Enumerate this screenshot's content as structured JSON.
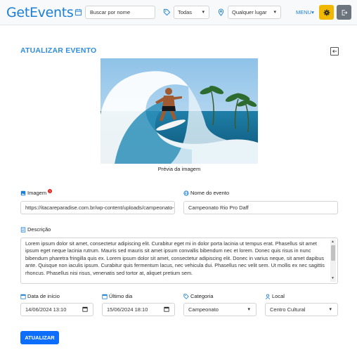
{
  "navbar": {
    "brand": "GetEvents",
    "search_placeholder": "Buscar por nome",
    "category_value": "Todas",
    "location_value": "Qualquer lugar",
    "menu_label": "MENU",
    "chevron": "▾"
  },
  "page": {
    "title": "ATUALIZAR EVENTO",
    "preview_caption": "Prévia da imagem"
  },
  "form": {
    "image_label": "Imagem",
    "image_value": "https://itacareparadise.com.br/wp-content/uploads/campeonato-surf.jpg",
    "name_label": "Nome do evento",
    "name_value": "Campeonato Rio Pro Daff",
    "description_label": "Descrição",
    "description_value": "Lorem ipsum dolor sit amet, consectetur adipiscing elit. Curabitur eget mi in dolor porta lacinia ut tempus erat. Phasellus sit amet ipsum eget neque lacinia rutrum. Mauris sed mauris sit amet ipsum convallis bibendum nec et lorem. Donec quis risus in nunc bibendum pharetra fringilla quis ex. Lorem ipsum dolor sit amet, consectetur adipiscing elit. Donec in varius neque, sit amet dapibus ante. Quisque non iaculis ipsum. Curabitur quis fermentum lacus, nec vehicula dui. Phasellus nec velit sem. Ut mollis ex nec sagittis rhoncus. Phasellus nisi risus, venenatis sed tortor at, aliquet pretium sem.",
    "start_label": "Data de início",
    "start_value": "14/06/2024 13:10",
    "end_label": "Último dia",
    "end_value": "15/06/2024 18:10",
    "category_label": "Categoria",
    "category_value": "Campeonato",
    "location_label": "Local",
    "location_value": "Centro Cultural",
    "submit_label": "ATUALIZAR"
  },
  "colors": {
    "accent": "#1a7fd4",
    "title": "#2f8de0",
    "primary_button": "#0d6efd",
    "warning_button": "#f0b800",
    "secondary_button": "#6c757d"
  },
  "icons": {
    "search": "calendar-search-icon",
    "category": "tag-icon",
    "location": "map-pin-icon",
    "settings": "gear-icon",
    "logout": "logout-icon",
    "back": "back-arrow-icon"
  }
}
